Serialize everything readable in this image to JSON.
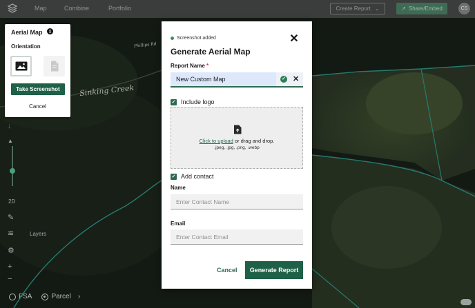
{
  "topbar": {
    "nav": [
      "Map",
      "Combine",
      "Portfolio"
    ],
    "create_report": "Create Report",
    "share": "Share/Embed",
    "avatar": "CS"
  },
  "map": {
    "labels": [
      "Sinking Creek",
      "Phillips Rd"
    ],
    "toolbar": [
      "2D",
      "Layers"
    ]
  },
  "bottom_bar": {
    "options": [
      "FSA",
      "Parcel"
    ],
    "selected": "Parcel"
  },
  "aerial_panel": {
    "title": "Aerial Map",
    "orientation_label": "Orientation",
    "orientations": [
      "landscape",
      "portrait"
    ],
    "selected_orientation": "landscape",
    "take_screenshot": "Take Screenshot",
    "cancel": "Cancel"
  },
  "modal": {
    "status": "Screenshot added",
    "title": "Generate Aerial Map",
    "report_name_label": "Report Name",
    "required_mark": "*",
    "report_name_value": "New Custom Map",
    "include_logo_label": "Include logo",
    "include_logo_checked": true,
    "upload_link": "Click to upload",
    "upload_rest": " or drag and drop.",
    "upload_types": ".jpeg, .jpg, .png, .webp",
    "add_contact_label": "Add contact",
    "add_contact_checked": true,
    "name_label": "Name",
    "name_placeholder": "Enter Contact Name",
    "email_label": "Email",
    "email_placeholder": "Enter Contact Email",
    "cancel": "Cancel",
    "generate": "Generate Report"
  },
  "colors": {
    "accent": "#1f6048",
    "parcel_outline": "#3fc6b4",
    "success": "#2d7e57"
  }
}
